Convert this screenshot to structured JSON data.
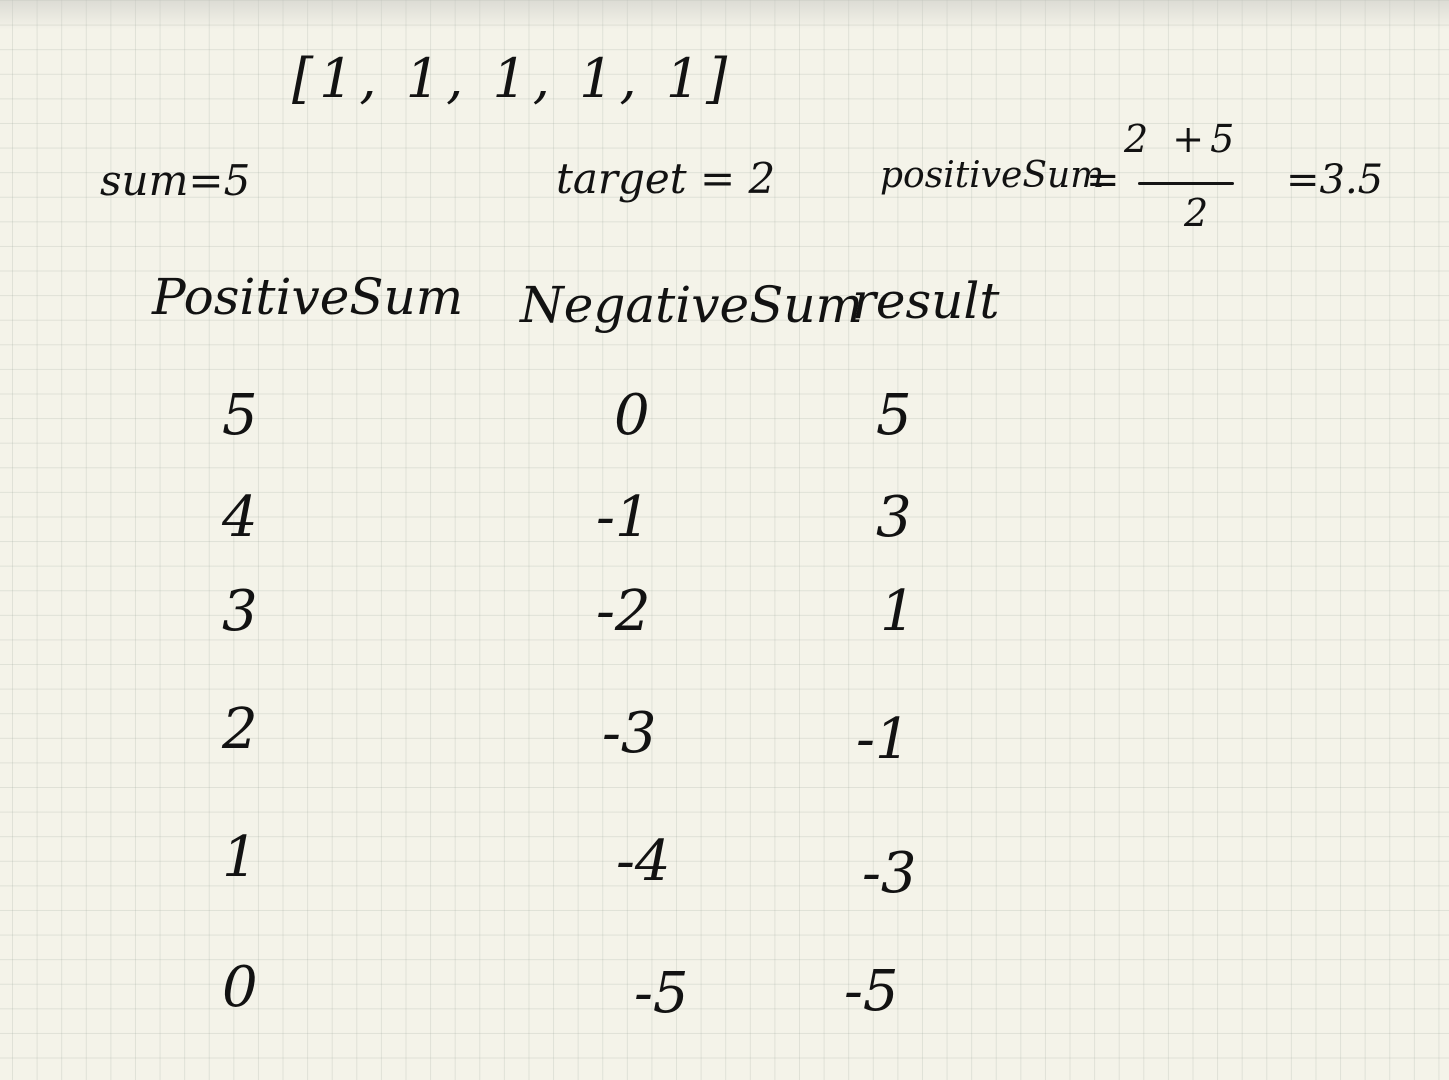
{
  "array": "[1, 1, 1, 1, 1]",
  "sum_label": "sum=5",
  "target_label": "target = 2",
  "positive_formula": {
    "name": "positiveSum",
    "equals": "=",
    "numerator": "2 +5",
    "denominator": "2",
    "result": "=3.5"
  },
  "table": {
    "headers": [
      "PositiveSum",
      "NegativeSum",
      "result"
    ],
    "rows": [
      [
        "5",
        "0",
        "5"
      ],
      [
        "4",
        "-1",
        "3"
      ],
      [
        "3",
        "-2",
        "1"
      ],
      [
        "2",
        "-3",
        "-1"
      ],
      [
        "1",
        "-4",
        "-3"
      ],
      [
        "0",
        "-5",
        "-5"
      ]
    ]
  },
  "colors": {
    "paper": "#f4f3e9",
    "ink": "#121212",
    "grid": "#c9ccc3"
  }
}
